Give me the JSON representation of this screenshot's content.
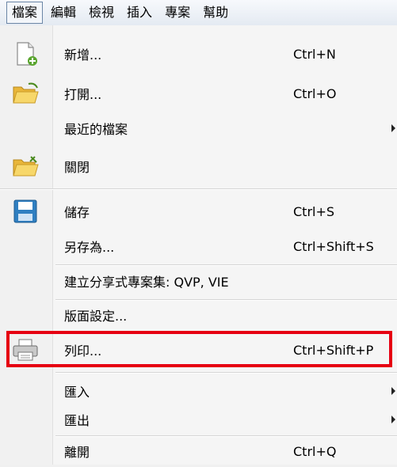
{
  "menubar": {
    "items": [
      "檔案",
      "編輯",
      "檢視",
      "插入",
      "專案",
      "幫助"
    ]
  },
  "menu": {
    "items": {
      "new": {
        "label": "新增...",
        "shortcut": "Ctrl+N",
        "icon": "new-file-icon"
      },
      "open": {
        "label": "打開...",
        "shortcut": "Ctrl+O",
        "icon": "folder-open-icon"
      },
      "recent": {
        "label": "最近的檔案"
      },
      "close": {
        "label": "關閉",
        "icon": "folder-close-icon"
      },
      "save": {
        "label": "儲存",
        "shortcut": "Ctrl+S",
        "icon": "save-disk-icon"
      },
      "saveas": {
        "label": "另存為...",
        "shortcut": "Ctrl+Shift+S"
      },
      "share": {
        "label": "建立分享式專案集: QVP, VIE"
      },
      "pagesetup": {
        "label": "版面設定..."
      },
      "print": {
        "label": "列印...",
        "shortcut": "Ctrl+Shift+P",
        "icon": "printer-icon"
      },
      "import": {
        "label": "匯入"
      },
      "export": {
        "label": "匯出"
      },
      "exit": {
        "label": "離開",
        "shortcut": "Ctrl+Q"
      }
    }
  },
  "colors": {
    "highlight_box": "#e60012",
    "menu_background": "#f5f5f5"
  }
}
